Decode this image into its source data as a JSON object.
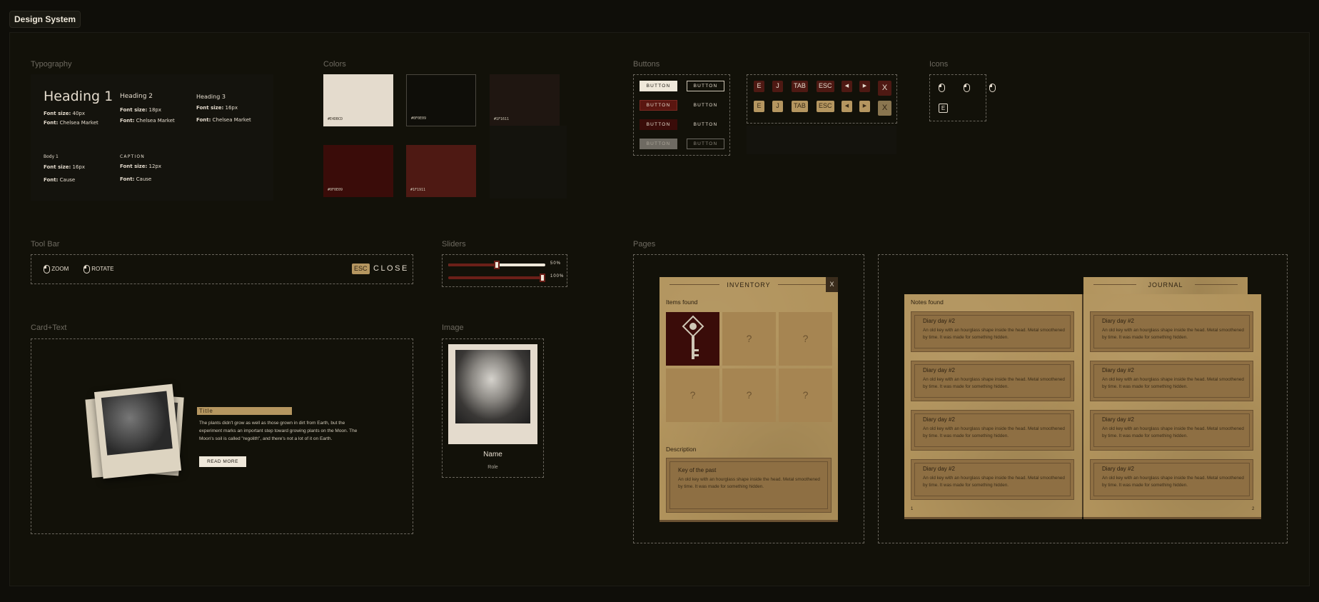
{
  "frame": {
    "title": "Design System"
  },
  "colors_meta": {
    "bg": "#0f0e09",
    "cream": "#e4dbcd",
    "dark": "#0f0e09",
    "brown": "#1f1611",
    "maroon": "#3a0c09",
    "red": "#4e1913",
    "paper": "#b1935c"
  },
  "sections": {
    "typography": "Typography",
    "colors": "Colors",
    "buttons": "Buttons",
    "icons": "Icons",
    "toolbar": "Tool Bar",
    "sliders": "Sliders",
    "pages": "Pages",
    "card": "Card+Text",
    "image": "Image"
  },
  "typography": {
    "h1": {
      "sample": "Heading 1",
      "size_label": "Font size:",
      "size": "40px",
      "font_label": "Font:",
      "font": "Chelsea Market"
    },
    "h2": {
      "sample": "Heading 2",
      "size_label": "Font size:",
      "size": "18px",
      "font_label": "Font:",
      "font": "Chelsea Market"
    },
    "h3": {
      "sample": "Heading 3",
      "size_label": "Font size:",
      "size": "16px",
      "font_label": "Font:",
      "font": "Chelsea Market"
    },
    "body": {
      "sample": "Body 1",
      "size_label": "Font size:",
      "size": "16px",
      "font_label": "Font:",
      "font": "Cause"
    },
    "caption": {
      "sample": "CAPTION",
      "size_label": "Font size:",
      "size": "12px",
      "font_label": "Font:",
      "font": "Cause"
    }
  },
  "swatches": [
    "#E4DBCD",
    "#0F0E09",
    "#1F1611",
    "#0F0E09",
    "#1F1911"
  ],
  "buttons": {
    "label": "BUTTON"
  },
  "keys": {
    "row1": [
      "E",
      "J",
      "TAB",
      "ESC"
    ],
    "x": "X",
    "play_left": "◀",
    "play_right": "▶"
  },
  "icons_keys": {
    "e": "E"
  },
  "toolbar": {
    "zoom": "ZOOM",
    "rotate": "ROTATE",
    "esc": "ESC",
    "close": "CLOSE"
  },
  "sliders": [
    {
      "value": 0.5,
      "label": "50%"
    },
    {
      "value": 1.0,
      "label": "100%"
    }
  ],
  "card": {
    "title": "Title",
    "body": "The plants didn't grow as well as those grown in dirt from Earth, but the experiment marks an important step toward growing plants on the Moon. The Moon's soil is called \"regolith\", and there's not a lot of it on Earth.",
    "button": "READ MORE"
  },
  "image_card": {
    "name": "Name",
    "role": "Role"
  },
  "inventory": {
    "title": "INVENTORY",
    "close": "X",
    "items_found": "Items found",
    "unknown": "?",
    "description_label": "Description",
    "desc_title": "Key of the past",
    "desc_body": "An old key with an hourglass shape inside the head. Metal smoothened by time. It was made for something hidden."
  },
  "journal": {
    "title": "JOURNAL",
    "notes_found": "Notes found",
    "note_title": "Diary day #2",
    "note_body": "An old key with an hourglass shape inside the head. Metal smoothened by time. It was made for something hidden.",
    "page_left": "1",
    "page_right": "2"
  }
}
